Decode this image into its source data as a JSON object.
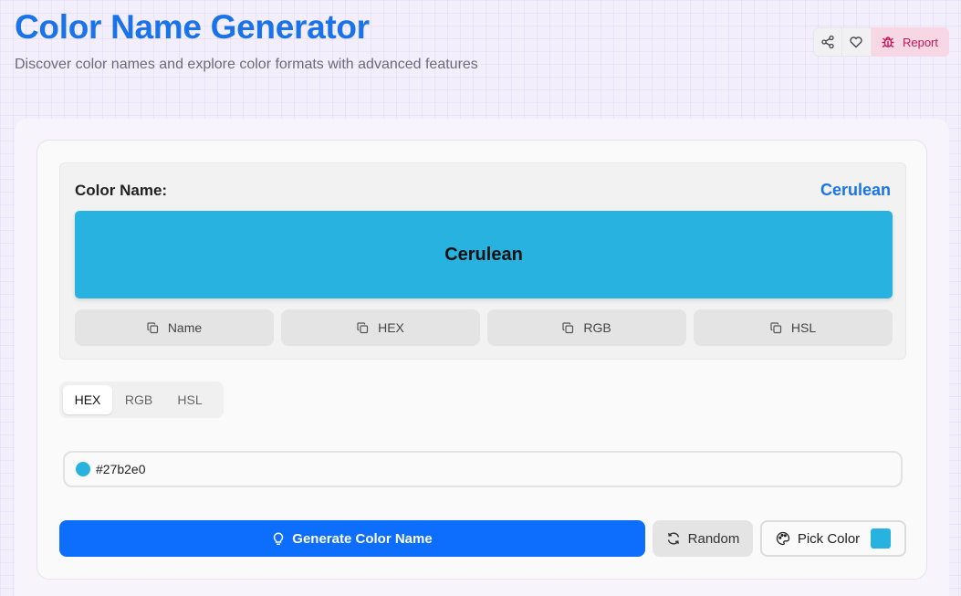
{
  "header": {
    "title": "Color Name Generator",
    "subtitle": "Discover color names and explore color formats with advanced features",
    "share_icon": "share-icon",
    "favorite_icon": "heart-icon",
    "report_label": "Report",
    "report_icon": "bug-icon"
  },
  "result": {
    "label": "Color Name:",
    "name": "Cerulean",
    "swatch_text": "Cerulean",
    "color": "#27b2e0",
    "copy_buttons": [
      {
        "label": "Name",
        "icon": "copy-icon"
      },
      {
        "label": "HEX",
        "icon": "copy-icon"
      },
      {
        "label": "RGB",
        "icon": "copy-icon"
      },
      {
        "label": "HSL",
        "icon": "copy-icon"
      }
    ]
  },
  "formats": {
    "tabs": [
      "HEX",
      "RGB",
      "HSL"
    ],
    "active": "HEX"
  },
  "input": {
    "value": "#27b2e0"
  },
  "actions": {
    "generate_label": "Generate Color Name",
    "generate_icon": "lightbulb-icon",
    "random_label": "Random",
    "random_icon": "refresh-icon",
    "pick_label": "Pick Color",
    "pick_icon": "palette-icon"
  },
  "colors": {
    "brand": "#1a73e8",
    "primary_button": "#0d6efd",
    "report_bg": "#f8d7e4",
    "report_text": "#c2185b"
  }
}
